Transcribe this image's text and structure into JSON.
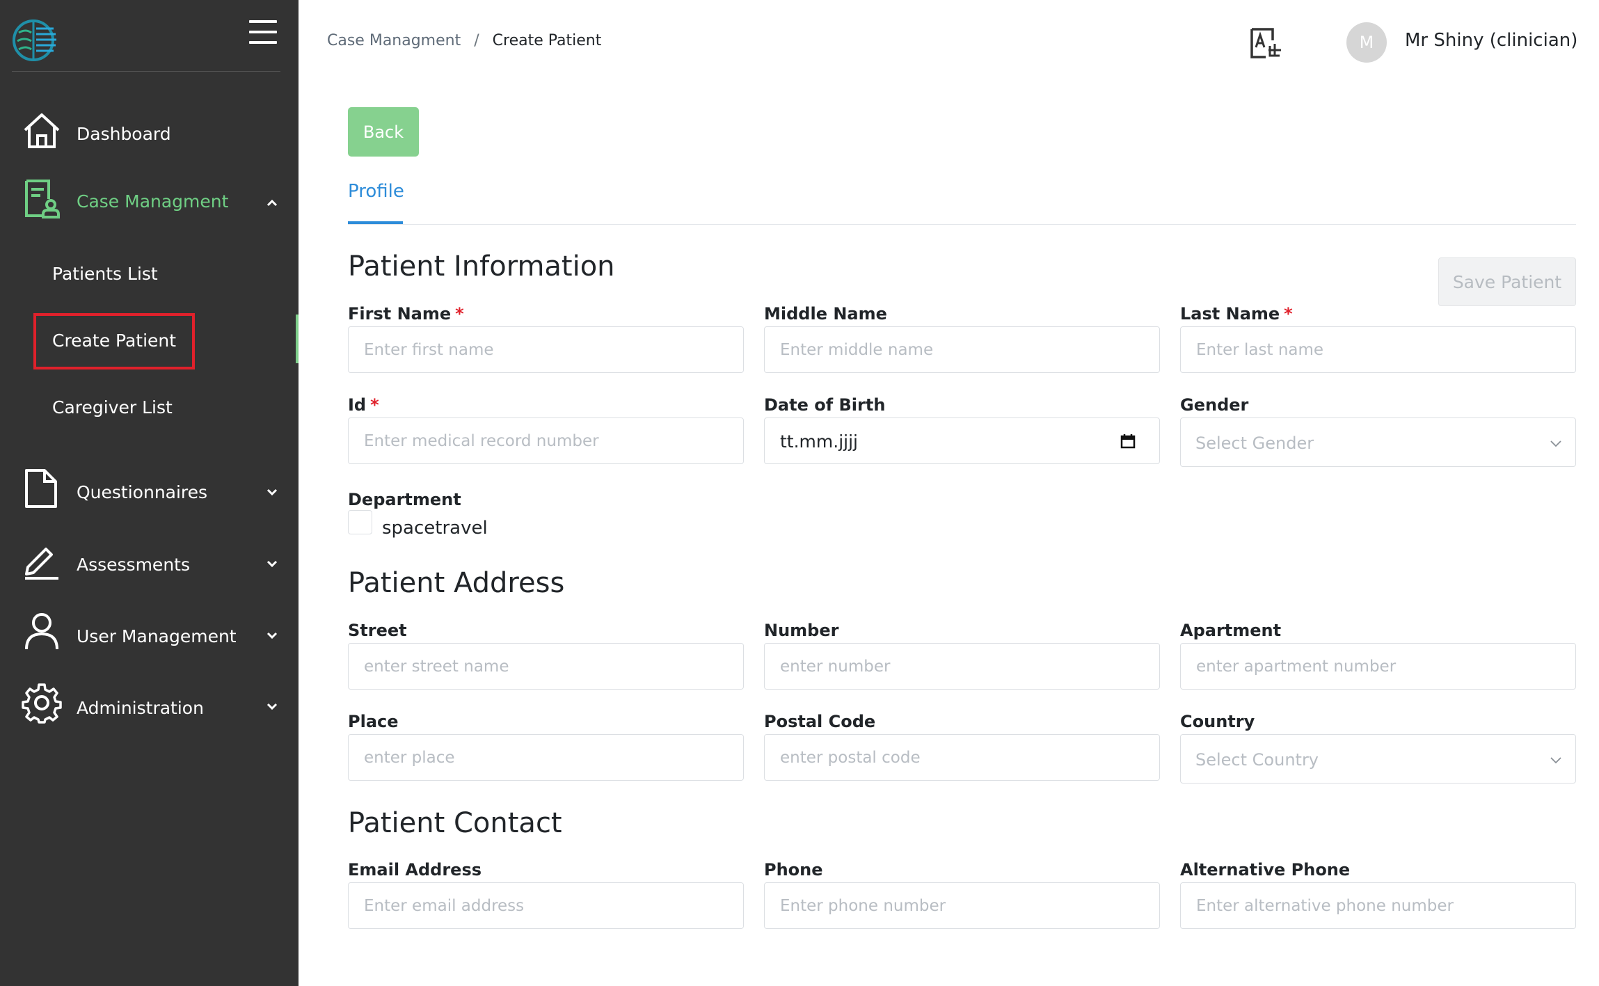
{
  "sidebar": {
    "items": [
      {
        "label": "Dashboard",
        "icon": "home-icon"
      },
      {
        "label": "Case Managment",
        "icon": "case-icon"
      },
      {
        "label": "Questionnaires",
        "icon": "document-icon"
      },
      {
        "label": "Assessments",
        "icon": "pen-icon"
      },
      {
        "label": "User Management",
        "icon": "user-icon"
      },
      {
        "label": "Administration",
        "icon": "gear-icon"
      }
    ],
    "subitems": [
      {
        "label": "Patients List"
      },
      {
        "label": "Create Patient"
      },
      {
        "label": "Caregiver List"
      }
    ]
  },
  "header": {
    "breadcrumb": {
      "parent": "Case Managment",
      "separator": "/",
      "current": "Create Patient"
    },
    "avatar_initial": "M",
    "user_name": "Mr Shiny (clinician)"
  },
  "main": {
    "back_label": "Back",
    "tab_label": "Profile",
    "save_label": "Save Patient",
    "required_mark": "*",
    "info": {
      "title": "Patient Information",
      "first_name": {
        "label": "First Name",
        "placeholder": "Enter first name"
      },
      "middle_name": {
        "label": "Middle Name",
        "placeholder": "Enter middle name"
      },
      "last_name": {
        "label": "Last Name",
        "placeholder": "Enter last name"
      },
      "id": {
        "label": "Id",
        "placeholder": "Enter medical record number"
      },
      "dob": {
        "label": "Date of Birth",
        "value": "tt.mm.jjjj"
      },
      "gender": {
        "label": "Gender",
        "placeholder": "Select Gender"
      },
      "department": {
        "label": "Department",
        "option": "spacetravel"
      }
    },
    "address": {
      "title": "Patient Address",
      "street": {
        "label": "Street",
        "placeholder": "enter street name"
      },
      "number": {
        "label": "Number",
        "placeholder": "enter number"
      },
      "apartment": {
        "label": "Apartment",
        "placeholder": "enter apartment number"
      },
      "place": {
        "label": "Place",
        "placeholder": "enter place"
      },
      "postal": {
        "label": "Postal Code",
        "placeholder": "enter postal code"
      },
      "country": {
        "label": "Country",
        "placeholder": "Select Country"
      }
    },
    "contact": {
      "title": "Patient Contact",
      "email": {
        "label": "Email Address",
        "placeholder": "Enter email address"
      },
      "phone": {
        "label": "Phone",
        "placeholder": "Enter phone number"
      },
      "alt_phone": {
        "label": "Alternative Phone",
        "placeholder": "Enter alternative phone number"
      }
    }
  },
  "colors": {
    "sidebar_bg": "#333333",
    "accent_green": "#6fcf84",
    "tab_blue": "#2d8cd9",
    "required_red": "#e0212b",
    "highlight_red": "#e0212b"
  }
}
